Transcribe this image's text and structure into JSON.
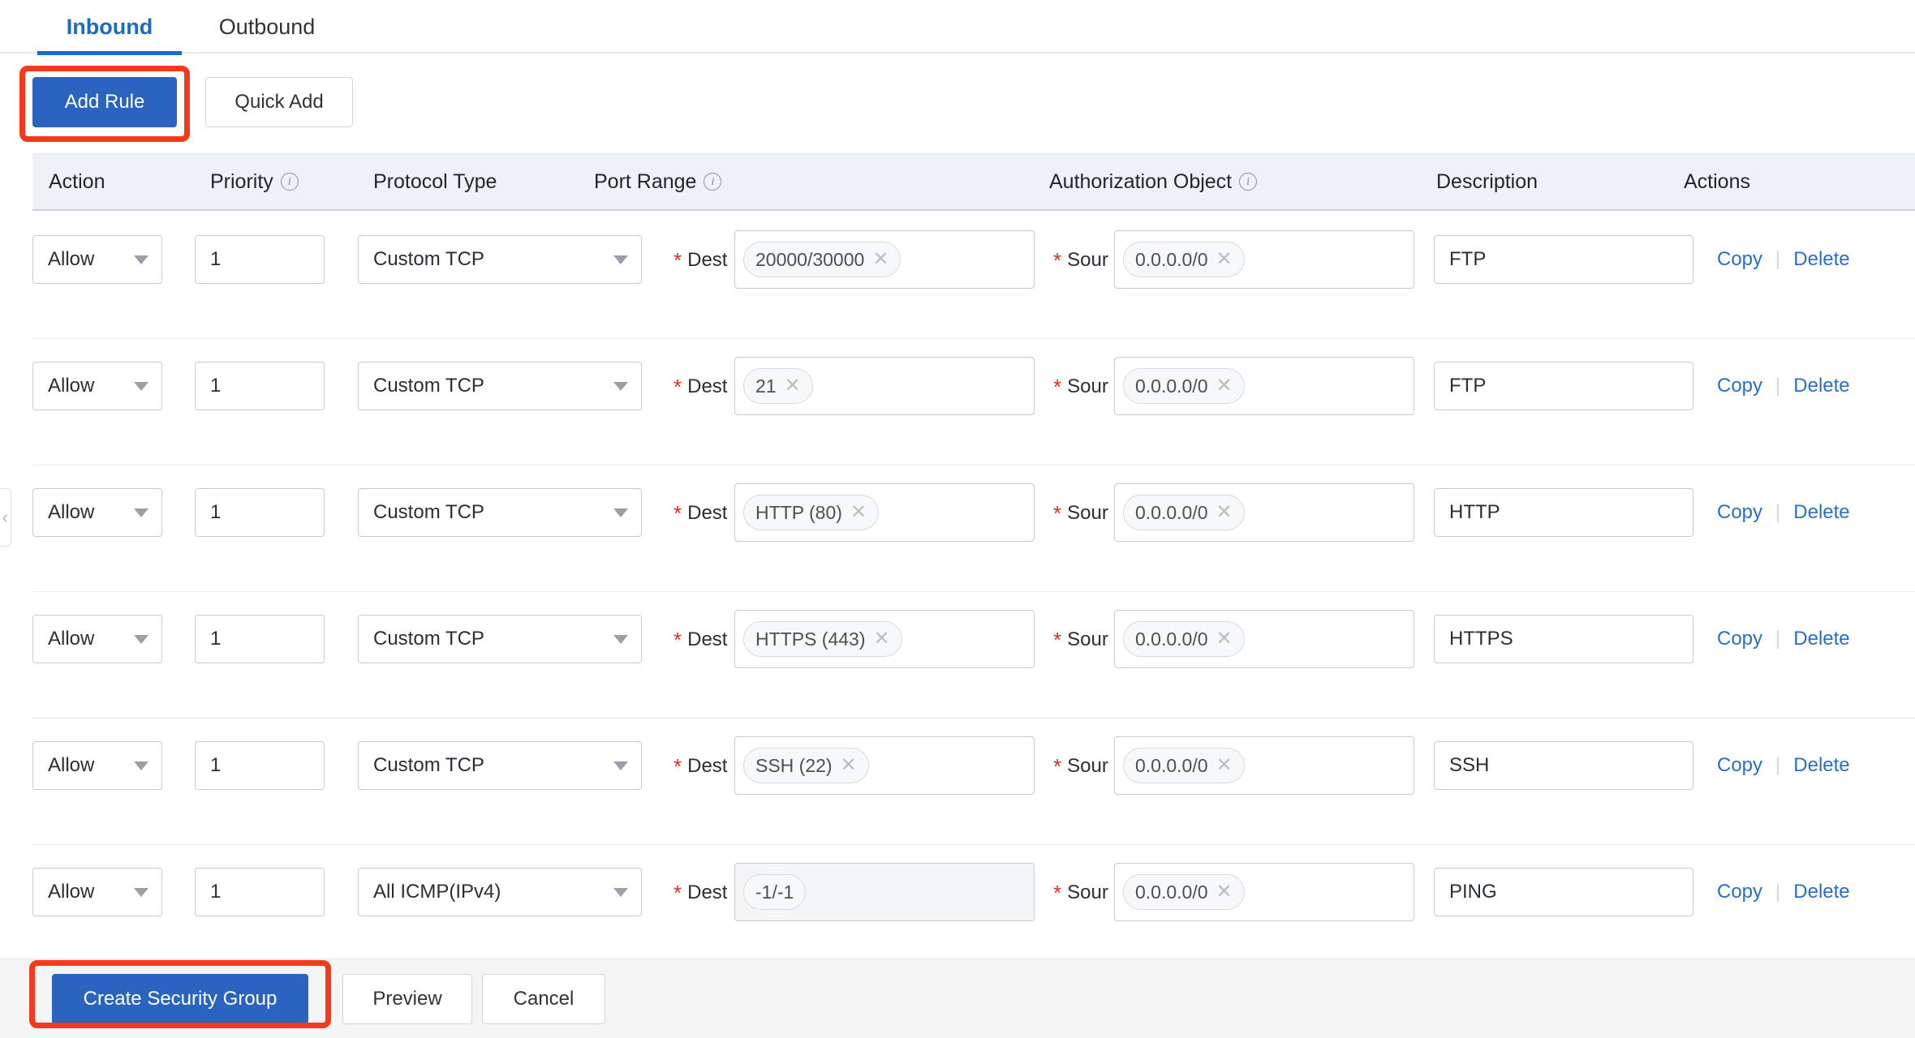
{
  "tabs": [
    {
      "label": "Inbound",
      "active": true
    },
    {
      "label": "Outbound",
      "active": false
    }
  ],
  "toolbar": {
    "add_rule_label": "Add Rule",
    "quick_add_label": "Quick Add"
  },
  "table": {
    "headers": {
      "action": "Action",
      "priority": "Priority",
      "protocol": "Protocol Type",
      "port_range": "Port Range",
      "authorization": "Authorization Object",
      "description": "Description",
      "actions": "Actions"
    },
    "row_labels": {
      "dest": "Dest",
      "source": "Sour",
      "required_marker": "*"
    },
    "action_links": {
      "copy": "Copy",
      "delete": "Delete",
      "separator": "|"
    },
    "rows": [
      {
        "action": "Allow",
        "priority": "1",
        "protocol": "Custom TCP",
        "port_tag": "20000/30000",
        "port_removable": true,
        "port_disabled": false,
        "auth_tag": "0.0.0.0/0",
        "description": "FTP"
      },
      {
        "action": "Allow",
        "priority": "1",
        "protocol": "Custom TCP",
        "port_tag": "21",
        "port_removable": true,
        "port_disabled": false,
        "auth_tag": "0.0.0.0/0",
        "description": "FTP"
      },
      {
        "action": "Allow",
        "priority": "1",
        "protocol": "Custom TCP",
        "port_tag": "HTTP (80)",
        "port_removable": true,
        "port_disabled": false,
        "auth_tag": "0.0.0.0/0",
        "description": "HTTP"
      },
      {
        "action": "Allow",
        "priority": "1",
        "protocol": "Custom TCP",
        "port_tag": "HTTPS (443)",
        "port_removable": true,
        "port_disabled": false,
        "auth_tag": "0.0.0.0/0",
        "description": "HTTPS"
      },
      {
        "action": "Allow",
        "priority": "1",
        "protocol": "Custom TCP",
        "port_tag": "SSH (22)",
        "port_removable": true,
        "port_disabled": false,
        "auth_tag": "0.0.0.0/0",
        "description": "SSH"
      },
      {
        "action": "Allow",
        "priority": "1",
        "protocol": "All ICMP(IPv4)",
        "port_tag": "-1/-1",
        "port_removable": false,
        "port_disabled": true,
        "auth_tag": "0.0.0.0/0",
        "description": "PING"
      }
    ]
  },
  "footer": {
    "create_label": "Create Security Group",
    "preview_label": "Preview",
    "cancel_label": "Cancel"
  },
  "icons": {
    "info": "i",
    "tag_remove": "✕",
    "collapse_left": "‹"
  },
  "colors": {
    "primary_blue": "#2b63c0",
    "tab_active_blue": "#1a6bc9",
    "link_blue": "#2a6ecb",
    "annotation_red": "#f4391c",
    "required_red": "#d93026",
    "header_band": "#eef1f6",
    "footer_band": "#f5f5f5"
  }
}
